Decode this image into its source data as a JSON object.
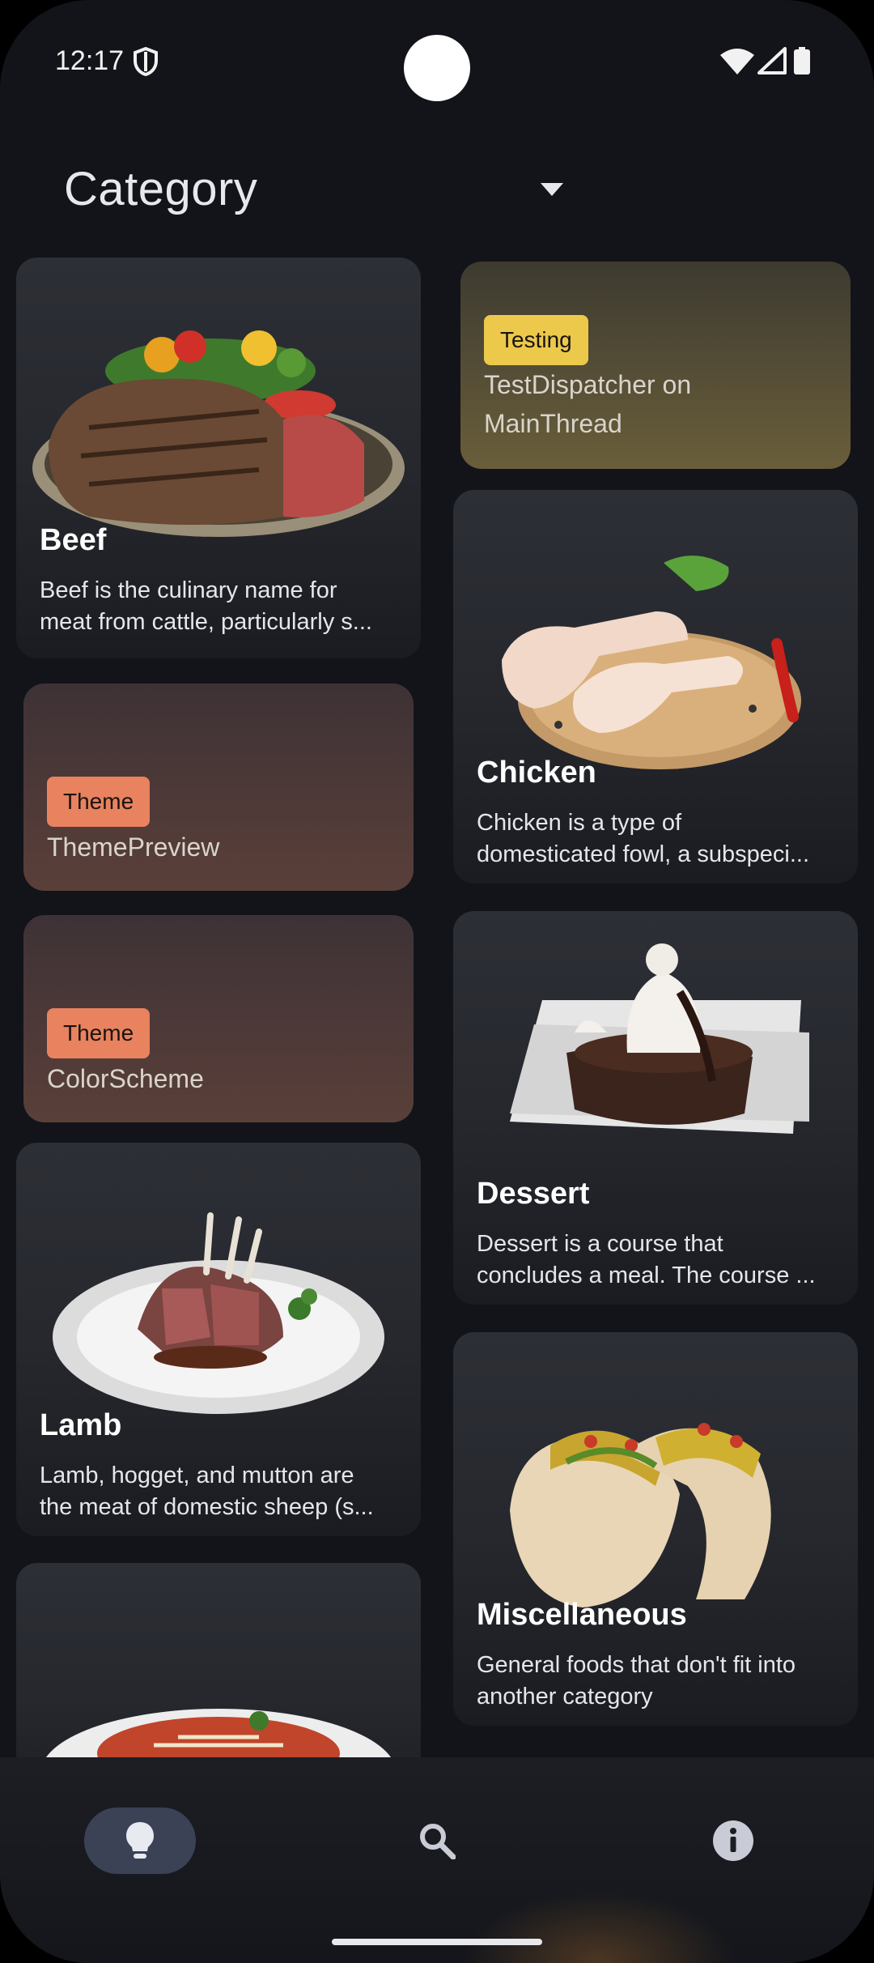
{
  "status_bar": {
    "time": "12:17"
  },
  "header": {
    "title": "Category"
  },
  "cards": {
    "beef": {
      "name": "Beef",
      "desc_line1": "Beef is the culinary name for",
      "desc_line2": "meat from cattle, particularly s..."
    },
    "testing": {
      "badge": "Testing",
      "title_line1": "TestDispatcher on",
      "title_line2": "MainThread"
    },
    "chicken": {
      "name": "Chicken",
      "desc_line1": "Chicken is a type of",
      "desc_line2": "domesticated fowl, a subspeci..."
    },
    "theme_preview": {
      "badge": "Theme",
      "title": "ThemePreview"
    },
    "color_scheme": {
      "badge": "Theme",
      "title": "ColorScheme"
    },
    "dessert": {
      "name": "Dessert",
      "desc_line1": "Dessert is a course that",
      "desc_line2": "concludes a meal. The course ..."
    },
    "lamb": {
      "name": "Lamb",
      "desc_line1": "Lamb, hogget, and mutton are",
      "desc_line2": "the meat of domestic sheep (s..."
    },
    "miscellaneous": {
      "name": "Miscellaneous",
      "desc_line1": "General foods that don't fit into",
      "desc_line2": "another category"
    }
  },
  "bottom_nav": {
    "items": [
      {
        "icon": "lightbulb-icon",
        "selected": true
      },
      {
        "icon": "search-icon",
        "selected": false
      },
      {
        "icon": "info-icon",
        "selected": false
      }
    ]
  },
  "colors": {
    "background": "#12141a",
    "testing_badge": "#ecc94b",
    "testing_card": "#5a5033",
    "theme_badge": "#e8825f",
    "theme_card": "#553c37",
    "nav_selected": "#3b4256"
  }
}
